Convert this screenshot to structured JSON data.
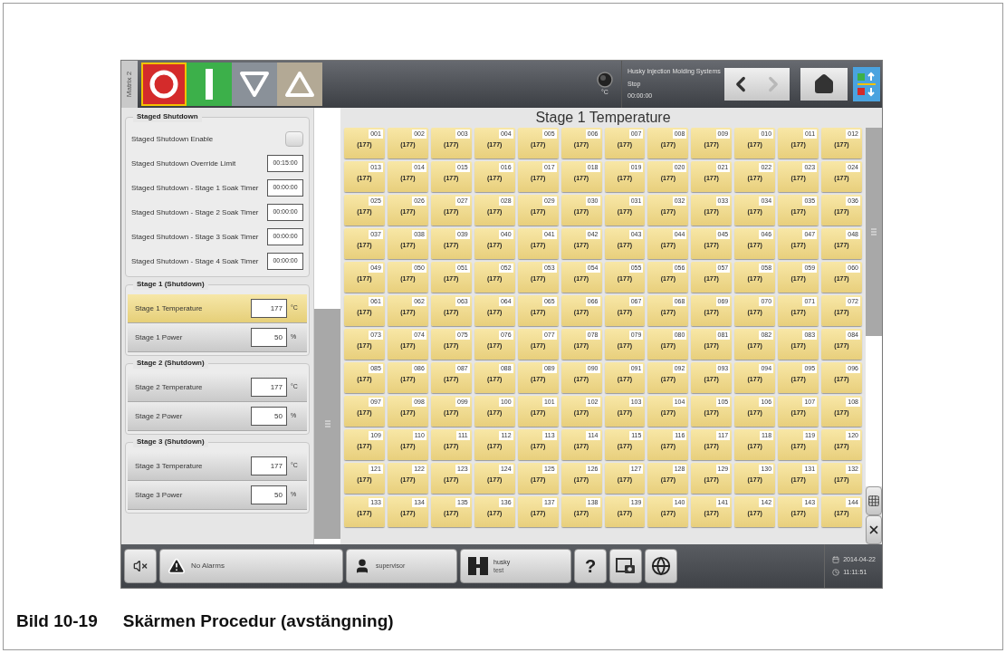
{
  "top_bar": {
    "side_tab": "Matrix 2",
    "mode_buttons": [
      {
        "kind": "stop",
        "selected": true
      },
      {
        "kind": "start",
        "selected": false
      },
      {
        "kind": "down",
        "selected": false
      },
      {
        "kind": "up",
        "selected": false
      }
    ],
    "status": {
      "unit": "°C",
      "company": "Husky Injection Molding Systems",
      "state": "Stop",
      "time": "00:00:00"
    },
    "nav": [
      {
        "kind": "back",
        "disabled": false
      },
      {
        "kind": "forward",
        "disabled": true
      }
    ]
  },
  "left_panel": {
    "groups": [
      {
        "title": "Staged Shutdown",
        "rows": [
          {
            "kind": "checkbox",
            "label": "Staged Shutdown Enable",
            "checked": false
          },
          {
            "kind": "field",
            "label": "Staged Shutdown Override Limit",
            "value": "00:15:00"
          },
          {
            "kind": "field",
            "label": "Staged Shutdown - Stage 1 Soak Timer",
            "value": "00:00:00"
          },
          {
            "kind": "field",
            "label": "Staged Shutdown - Stage 2 Soak Timer",
            "value": "00:00:00"
          },
          {
            "kind": "field",
            "label": "Staged Shutdown - Stage 3 Soak Timer",
            "value": "00:00:00"
          },
          {
            "kind": "field",
            "label": "Staged Shutdown - Stage 4 Soak Timer",
            "value": "00:00:00"
          }
        ]
      },
      {
        "title": "Stage 1 (Shutdown)",
        "rows": [
          {
            "kind": "setpoint",
            "label": "Stage 1 Temperature",
            "value": "177",
            "unit": "°C",
            "selected": true
          },
          {
            "kind": "setpoint",
            "label": "Stage 1 Power",
            "value": "50",
            "unit": "%",
            "selected": false
          }
        ]
      },
      {
        "title": "Stage 2 (Shutdown)",
        "rows": [
          {
            "kind": "setpoint",
            "label": "Stage 2 Temperature",
            "value": "177",
            "unit": "°C",
            "selected": false
          },
          {
            "kind": "setpoint",
            "label": "Stage 2 Power",
            "value": "50",
            "unit": "%",
            "selected": false
          }
        ]
      },
      {
        "title": "Stage 3 (Shutdown)",
        "rows": [
          {
            "kind": "setpoint",
            "label": "Stage 3 Temperature",
            "value": "177",
            "unit": "°C",
            "selected": false
          },
          {
            "kind": "setpoint",
            "label": "Stage 3 Power",
            "value": "50",
            "unit": "%",
            "selected": false
          }
        ]
      }
    ]
  },
  "grid": {
    "title": "Stage 1 Temperature",
    "tiles": [
      {
        "number": "001",
        "value": "(177)"
      },
      {
        "number": "002",
        "value": "(177)"
      },
      {
        "number": "003",
        "value": "(177)"
      },
      {
        "number": "004",
        "value": "(177)"
      },
      {
        "number": "005",
        "value": "(177)"
      },
      {
        "number": "006",
        "value": "(177)"
      },
      {
        "number": "007",
        "value": "(177)"
      },
      {
        "number": "008",
        "value": "(177)"
      },
      {
        "number": "009",
        "value": "(177)"
      },
      {
        "number": "010",
        "value": "(177)"
      },
      {
        "number": "011",
        "value": "(177)"
      },
      {
        "number": "012",
        "value": "(177)"
      },
      {
        "number": "013",
        "value": "(177)"
      },
      {
        "number": "014",
        "value": "(177)"
      },
      {
        "number": "015",
        "value": "(177)"
      },
      {
        "number": "016",
        "value": "(177)"
      },
      {
        "number": "017",
        "value": "(177)"
      },
      {
        "number": "018",
        "value": "(177)"
      },
      {
        "number": "019",
        "value": "(177)"
      },
      {
        "number": "020",
        "value": "(177)"
      },
      {
        "number": "021",
        "value": "(177)"
      },
      {
        "number": "022",
        "value": "(177)"
      },
      {
        "number": "023",
        "value": "(177)"
      },
      {
        "number": "024",
        "value": "(177)"
      },
      {
        "number": "025",
        "value": "(177)"
      },
      {
        "number": "026",
        "value": "(177)"
      },
      {
        "number": "027",
        "value": "(177)"
      },
      {
        "number": "028",
        "value": "(177)"
      },
      {
        "number": "029",
        "value": "(177)"
      },
      {
        "number": "030",
        "value": "(177)"
      },
      {
        "number": "031",
        "value": "(177)"
      },
      {
        "number": "032",
        "value": "(177)"
      },
      {
        "number": "033",
        "value": "(177)"
      },
      {
        "number": "034",
        "value": "(177)"
      },
      {
        "number": "035",
        "value": "(177)"
      },
      {
        "number": "036",
        "value": "(177)"
      },
      {
        "number": "037",
        "value": "(177)"
      },
      {
        "number": "038",
        "value": "(177)"
      },
      {
        "number": "039",
        "value": "(177)"
      },
      {
        "number": "040",
        "value": "(177)"
      },
      {
        "number": "041",
        "value": "(177)"
      },
      {
        "number": "042",
        "value": "(177)"
      },
      {
        "number": "043",
        "value": "(177)"
      },
      {
        "number": "044",
        "value": "(177)"
      },
      {
        "number": "045",
        "value": "(177)"
      },
      {
        "number": "046",
        "value": "(177)"
      },
      {
        "number": "047",
        "value": "(177)"
      },
      {
        "number": "048",
        "value": "(177)"
      },
      {
        "number": "049",
        "value": "(177)"
      },
      {
        "number": "050",
        "value": "(177)"
      },
      {
        "number": "051",
        "value": "(177)"
      },
      {
        "number": "052",
        "value": "(177)"
      },
      {
        "number": "053",
        "value": "(177)"
      },
      {
        "number": "054",
        "value": "(177)"
      },
      {
        "number": "055",
        "value": "(177)"
      },
      {
        "number": "056",
        "value": "(177)"
      },
      {
        "number": "057",
        "value": "(177)"
      },
      {
        "number": "058",
        "value": "(177)"
      },
      {
        "number": "059",
        "value": "(177)"
      },
      {
        "number": "060",
        "value": "(177)"
      },
      {
        "number": "061",
        "value": "(177)"
      },
      {
        "number": "062",
        "value": "(177)"
      },
      {
        "number": "063",
        "value": "(177)"
      },
      {
        "number": "064",
        "value": "(177)"
      },
      {
        "number": "065",
        "value": "(177)"
      },
      {
        "number": "066",
        "value": "(177)"
      },
      {
        "number": "067",
        "value": "(177)"
      },
      {
        "number": "068",
        "value": "(177)"
      },
      {
        "number": "069",
        "value": "(177)"
      },
      {
        "number": "070",
        "value": "(177)"
      },
      {
        "number": "071",
        "value": "(177)"
      },
      {
        "number": "072",
        "value": "(177)"
      },
      {
        "number": "073",
        "value": "(177)"
      },
      {
        "number": "074",
        "value": "(177)"
      },
      {
        "number": "075",
        "value": "(177)"
      },
      {
        "number": "076",
        "value": "(177)"
      },
      {
        "number": "077",
        "value": "(177)"
      },
      {
        "number": "078",
        "value": "(177)"
      },
      {
        "number": "079",
        "value": "(177)"
      },
      {
        "number": "080",
        "value": "(177)"
      },
      {
        "number": "081",
        "value": "(177)"
      },
      {
        "number": "082",
        "value": "(177)"
      },
      {
        "number": "083",
        "value": "(177)"
      },
      {
        "number": "084",
        "value": "(177)"
      },
      {
        "number": "085",
        "value": "(177)"
      },
      {
        "number": "086",
        "value": "(177)"
      },
      {
        "number": "087",
        "value": "(177)"
      },
      {
        "number": "088",
        "value": "(177)"
      },
      {
        "number": "089",
        "value": "(177)"
      },
      {
        "number": "090",
        "value": "(177)"
      },
      {
        "number": "091",
        "value": "(177)"
      },
      {
        "number": "092",
        "value": "(177)"
      },
      {
        "number": "093",
        "value": "(177)"
      },
      {
        "number": "094",
        "value": "(177)"
      },
      {
        "number": "095",
        "value": "(177)"
      },
      {
        "number": "096",
        "value": "(177)"
      },
      {
        "number": "097",
        "value": "(177)"
      },
      {
        "number": "098",
        "value": "(177)"
      },
      {
        "number": "099",
        "value": "(177)"
      },
      {
        "number": "100",
        "value": "(177)"
      },
      {
        "number": "101",
        "value": "(177)"
      },
      {
        "number": "102",
        "value": "(177)"
      },
      {
        "number": "103",
        "value": "(177)"
      },
      {
        "number": "104",
        "value": "(177)"
      },
      {
        "number": "105",
        "value": "(177)"
      },
      {
        "number": "106",
        "value": "(177)"
      },
      {
        "number": "107",
        "value": "(177)"
      },
      {
        "number": "108",
        "value": "(177)"
      },
      {
        "number": "109",
        "value": "(177)"
      },
      {
        "number": "110",
        "value": "(177)"
      },
      {
        "number": "111",
        "value": "(177)"
      },
      {
        "number": "112",
        "value": "(177)"
      },
      {
        "number": "113",
        "value": "(177)"
      },
      {
        "number": "114",
        "value": "(177)"
      },
      {
        "number": "115",
        "value": "(177)"
      },
      {
        "number": "116",
        "value": "(177)"
      },
      {
        "number": "117",
        "value": "(177)"
      },
      {
        "number": "118",
        "value": "(177)"
      },
      {
        "number": "119",
        "value": "(177)"
      },
      {
        "number": "120",
        "value": "(177)"
      },
      {
        "number": "121",
        "value": "(177)"
      },
      {
        "number": "122",
        "value": "(177)"
      },
      {
        "number": "123",
        "value": "(177)"
      },
      {
        "number": "124",
        "value": "(177)"
      },
      {
        "number": "125",
        "value": "(177)"
      },
      {
        "number": "126",
        "value": "(177)"
      },
      {
        "number": "127",
        "value": "(177)"
      },
      {
        "number": "128",
        "value": "(177)"
      },
      {
        "number": "129",
        "value": "(177)"
      },
      {
        "number": "130",
        "value": "(177)"
      },
      {
        "number": "131",
        "value": "(177)"
      },
      {
        "number": "132",
        "value": "(177)"
      },
      {
        "number": "133",
        "value": "(177)"
      },
      {
        "number": "134",
        "value": "(177)"
      },
      {
        "number": "135",
        "value": "(177)"
      },
      {
        "number": "136",
        "value": "(177)"
      },
      {
        "number": "137",
        "value": "(177)"
      },
      {
        "number": "138",
        "value": "(177)"
      },
      {
        "number": "139",
        "value": "(177)"
      },
      {
        "number": "140",
        "value": "(177)"
      },
      {
        "number": "141",
        "value": "(177)"
      },
      {
        "number": "142",
        "value": "(177)"
      },
      {
        "number": "143",
        "value": "(177)"
      },
      {
        "number": "144",
        "value": "(177)"
      }
    ]
  },
  "bottom_bar": {
    "alarm": "No Alarms",
    "user": "supervisor",
    "mold": {
      "name": "husky",
      "sub": "test"
    },
    "help": "?",
    "date": "2014-04-22",
    "time": "11:11:51"
  },
  "caption": {
    "number": "Bild 10-19",
    "text": "Skärmen Procedur (avstängning)"
  }
}
